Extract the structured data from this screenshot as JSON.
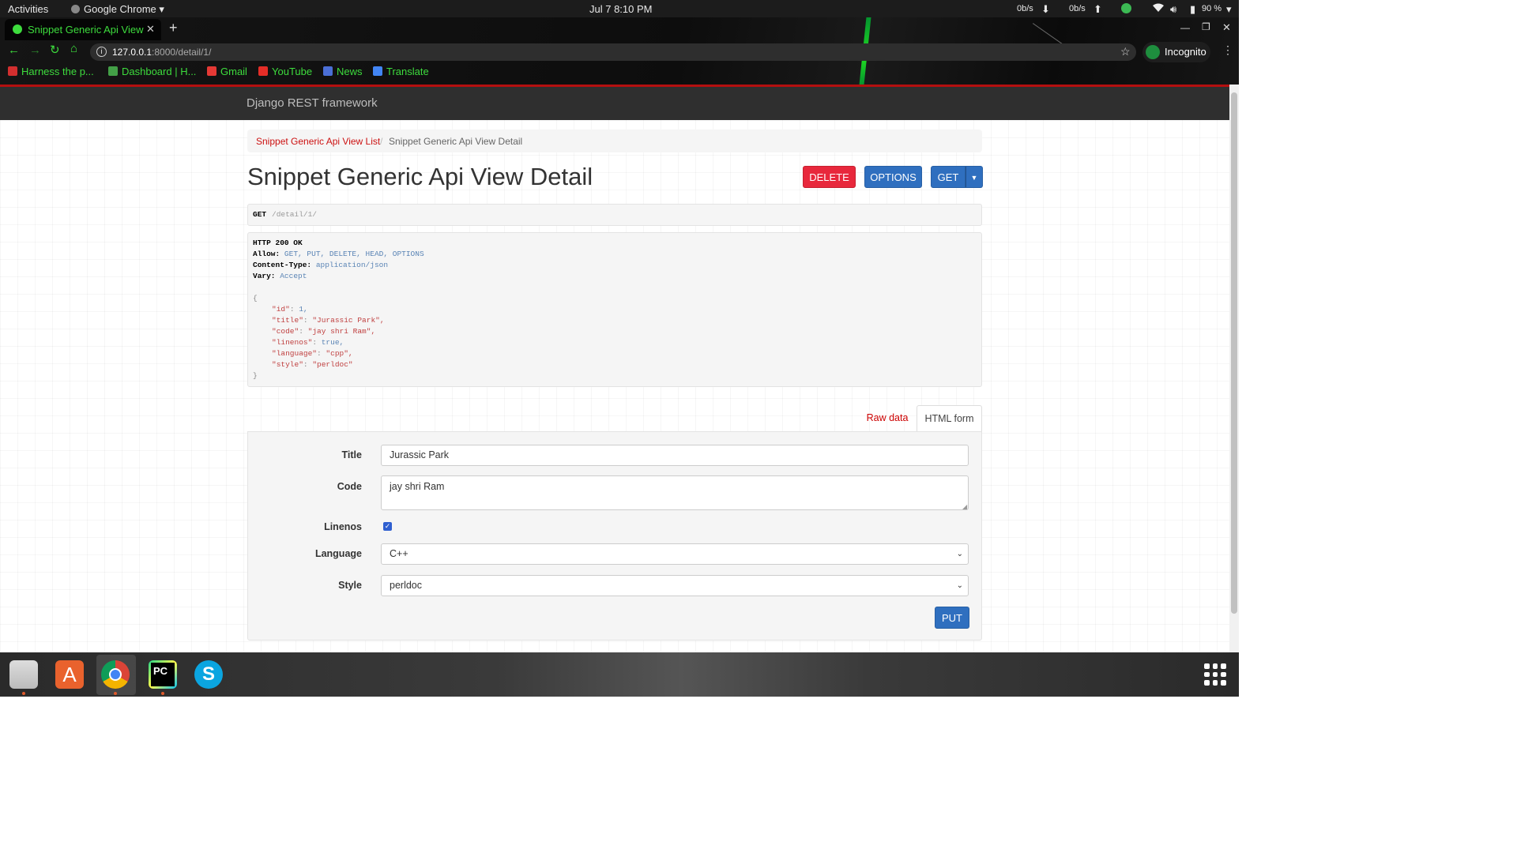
{
  "os_bar": {
    "activities": "Activities",
    "app_name": "Google Chrome",
    "datetime": "Jul 7  8:10 PM",
    "net_down": "0b/s",
    "net_up": "0b/s",
    "battery": "90 %"
  },
  "browser": {
    "tab_title": "Snippet Generic Api View",
    "url_host": "127.0.0.1",
    "url_rest": ":8000/detail/1/",
    "profile": "Incognito",
    "bookmarks": [
      {
        "label": "Harness the p...",
        "color": "#d32f2f"
      },
      {
        "label": "Dashboard | H...",
        "color": "#43a047"
      },
      {
        "label": "Gmail",
        "color": "#e53935"
      },
      {
        "label": "YouTube",
        "color": "#e52d27"
      },
      {
        "label": "News",
        "color": "#4b6fd6"
      },
      {
        "label": "Translate",
        "color": "#4285f4"
      }
    ]
  },
  "drf": {
    "brand": "Django REST framework",
    "breadcrumb_list": "Snippet Generic Api View List",
    "breadcrumb_sep": "/",
    "breadcrumb_current": "Snippet Generic Api View Detail",
    "page_title": "Snippet Generic Api View Detail",
    "buttons": {
      "delete": "DELETE",
      "options": "OPTIONS",
      "get": "GET"
    },
    "request": {
      "method": "GET",
      "path": "/detail/1/"
    },
    "response": {
      "status": "HTTP 200 OK",
      "allow_key": "Allow:",
      "allow_val": "GET, PUT, DELETE, HEAD, OPTIONS",
      "ctype_key": "Content-Type:",
      "ctype_val": "application/json",
      "vary_key": "Vary:",
      "vary_val": "Accept",
      "open_brace": "{",
      "close_brace": "}",
      "json_lines": [
        {
          "key": "\"id\"",
          "val": "1,",
          "val_is_str": false
        },
        {
          "key": "\"title\"",
          "val": "\"Jurassic Park\",",
          "val_is_str": true
        },
        {
          "key": "\"code\"",
          "val": "\"jay shri Ram\",",
          "val_is_str": true
        },
        {
          "key": "\"linenos\"",
          "val": "true,",
          "val_is_str": false
        },
        {
          "key": "\"language\"",
          "val": "\"cpp\",",
          "val_is_str": true
        },
        {
          "key": "\"style\"",
          "val": "\"perldoc\"",
          "val_is_str": true
        }
      ]
    },
    "tabs": {
      "raw": "Raw data",
      "html": "HTML form"
    },
    "form": {
      "title_label": "Title",
      "title_value": "Jurassic Park",
      "code_label": "Code",
      "code_value": "jay shri Ram",
      "linenos_label": "Linenos",
      "linenos_checked": true,
      "language_label": "Language",
      "language_value": "C++",
      "style_label": "Style",
      "style_value": "perldoc",
      "put": "PUT"
    },
    "colors": {
      "delete": "#e8283c",
      "primary": "#2f6fbf",
      "link": "#c11"
    }
  },
  "taskbar": {
    "apps": [
      "files-icon",
      "software-center-icon",
      "chrome-icon",
      "pycharm-icon",
      "skype-icon",
      "app-grid-icon"
    ]
  }
}
